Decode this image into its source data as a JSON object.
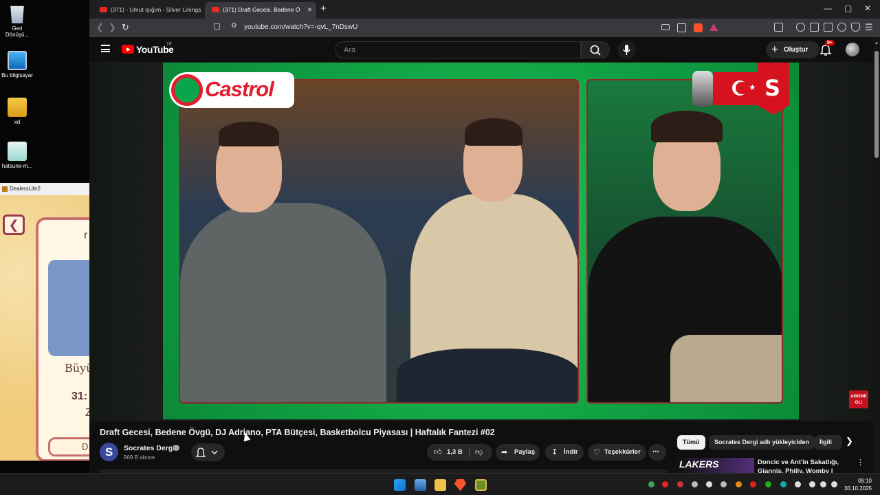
{
  "desktop": {
    "icons": [
      {
        "label": "Geri Dönüşü...",
        "icon": "recycle-bin-icon"
      },
      {
        "label": "Bu bilgisayar",
        "icon": "computer-icon"
      },
      {
        "label": "xd",
        "icon": "folder-icon"
      },
      {
        "label": "hatsune-m...",
        "icon": "image-file-icon"
      }
    ]
  },
  "dealers_window": {
    "title": "DealersLife2",
    "partial_texts": [
      "r",
      "Büyü",
      "31:",
      "Z",
      "D"
    ]
  },
  "browser": {
    "tabs": [
      {
        "label": "(371) - Umut Işığım - Silver Linings Pl"
      },
      {
        "label": "(371) Draft Gecesi, Bedene Ö"
      }
    ],
    "new_tab": "+",
    "url": "youtube.com/watch?v=-qvL_7nDswU",
    "window_controls": {
      "minimize": "—",
      "maximize": "▢",
      "close": "✕"
    }
  },
  "youtube": {
    "logo_text": "YouTube",
    "country": "TR",
    "search_placeholder": "Ara",
    "create_label": "Oluştur",
    "notifications_badge": "9+",
    "video": {
      "overlay_brand": "Castrol",
      "channel_badge": "S",
      "subscribe_sticker": "ABONE OL!"
    },
    "title": "Draft Gecesi, Bedene Övgü, DJ Adriano, PTA Bütçesi, Basketbolcu Piyasası | Haftalık Fantezi #02",
    "channel": {
      "avatar_letter": "S",
      "name": "Socrates Dergi",
      "subscribers": "969 B abone"
    },
    "actions": {
      "likes": "1,3 B",
      "share": "Paylaş",
      "download": "İndir",
      "thanks": "Teşekkürler",
      "more": "⋯"
    },
    "chips": [
      "Tümü",
      "Socrates Dergi adlı yükleyiciden",
      "İlgili"
    ],
    "recommendation": {
      "thumb_text": "LAKERS",
      "title": "Doncic ve Ant'in Sakatlığı, Giannis, Philly, Womby | Kaan..."
    }
  },
  "taskbar": {
    "apps": [
      "start-icon",
      "photos-icon",
      "file-explorer-icon",
      "brave-icon",
      "dealerslife-icon"
    ],
    "time": "09:10",
    "date": "30.10.2025"
  },
  "colors": {
    "yt_red": "#ff0000",
    "video_green": "#10a043",
    "castrol_red": "#e21d2d",
    "dark_bg": "#0f0f0f"
  }
}
